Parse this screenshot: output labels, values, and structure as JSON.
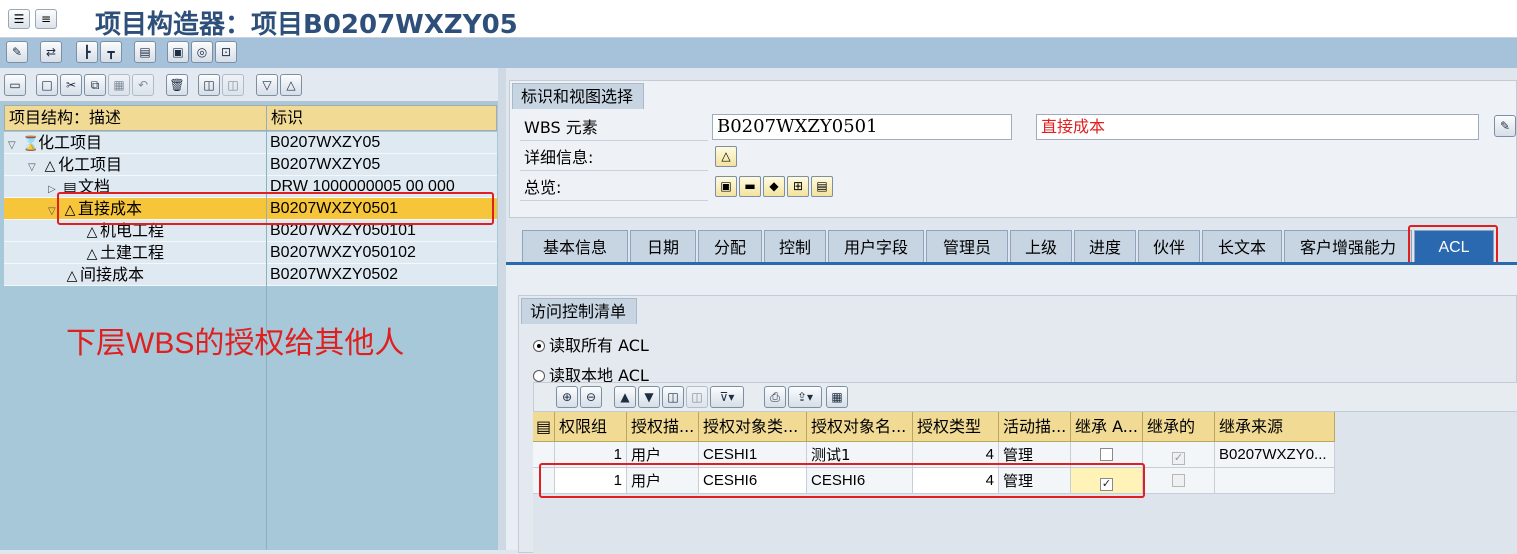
{
  "window": {
    "title": "项目构造器：项目B0207WXZY05"
  },
  "tree": {
    "header": {
      "col1": "项目结构：描述",
      "col2": "标识"
    },
    "rows": [
      {
        "desc": "化工项目",
        "id": "B0207WXZY05"
      },
      {
        "desc": "化工项目",
        "id": "B0207WXZY05"
      },
      {
        "desc": "文档",
        "id": "DRW 1000000005 00 000"
      },
      {
        "desc": "直接成本",
        "id": "B0207WXZY0501"
      },
      {
        "desc": "机电工程",
        "id": "B0207WXZY050101"
      },
      {
        "desc": "土建工程",
        "id": "B0207WXZY050102"
      },
      {
        "desc": "间接成本",
        "id": "B0207WXZY0502"
      }
    ]
  },
  "annotation": "下层WBS的授权给其他人",
  "selection": {
    "group_title": "标识和视图选择",
    "wbs_label": "WBS 元素",
    "wbs_value": "B0207WXZY0501",
    "wbs_desc": "直接成本",
    "detail_label": "详细信息:",
    "overview_label": "总览:"
  },
  "tabs": [
    "基本信息",
    "日期",
    "分配",
    "控制",
    "用户字段",
    "管理员",
    "上级",
    "进度",
    "伙伴",
    "长文本",
    "客户增强能力",
    "ACL"
  ],
  "acl": {
    "group_title": "访问控制清单",
    "radio_all": "读取所有 ACL",
    "radio_local": "读取本地 ACL",
    "columns": [
      "权限组",
      "授权描...",
      "授权对象类...",
      "授权对象名...",
      "授权类型",
      "活动描...",
      "继承 A...",
      "继承的",
      "继承来源"
    ],
    "rows": [
      {
        "group": "1",
        "desc": "用户",
        "obj_type": "CESHI1",
        "obj_name": "测试1",
        "auth_type": "4",
        "act": "管理",
        "inherit_a": false,
        "inherited": true,
        "source": "B0207WXZY0..."
      },
      {
        "group": "1",
        "desc": "用户",
        "obj_type": "CESHI6",
        "obj_name": "CESHI6",
        "auth_type": "4",
        "act": "管理",
        "inherit_a": true,
        "inherited": false,
        "source": ""
      }
    ]
  }
}
